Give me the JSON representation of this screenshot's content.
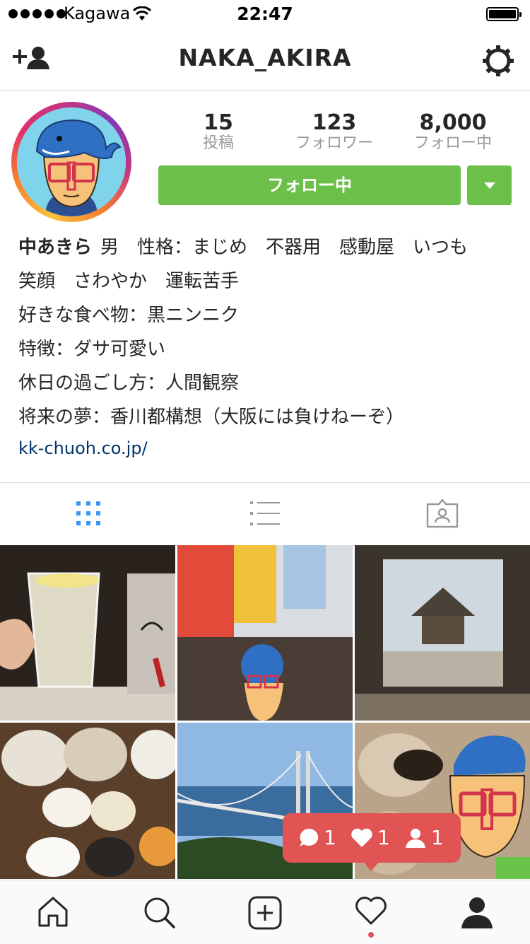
{
  "status_bar": {
    "carrier": "Kagawa",
    "time": "22:47"
  },
  "nav": {
    "username": "NAKA_AKIRA"
  },
  "profile": {
    "stats": [
      {
        "value": "15",
        "label": "投稿"
      },
      {
        "value": "123",
        "label": "フォロワー"
      },
      {
        "value": "8,000",
        "label": "フォロー中"
      }
    ],
    "follow_label": "フォロー中"
  },
  "bio": {
    "name": "中あきら",
    "line1": "男　性格：まじめ　不器用　感動屋　いつも",
    "line2": "笑顔　さわやか　運転苦手",
    "line3": "好きな食べ物：黒ニンニク",
    "line4": "特徴：ダサ可愛い",
    "line5": "休日の過ごし方：人間観察",
    "line6": "将来の夢：香川都構想（大阪には負けねーぞ）",
    "link": "kk-chuoh.co.jp/"
  },
  "activity_popup": {
    "comments": "1",
    "likes": "1",
    "follows": "1"
  },
  "colors": {
    "follow_green": "#6cc04a",
    "popup_red": "#e05454",
    "tab_active_blue": "#3897f0",
    "link_blue": "#003569"
  },
  "icons": [
    "add-user-icon",
    "gear-icon",
    "grid-icon",
    "list-icon",
    "tagged-icon",
    "home-icon",
    "search-icon",
    "add-post-icon",
    "heart-icon",
    "profile-icon"
  ]
}
